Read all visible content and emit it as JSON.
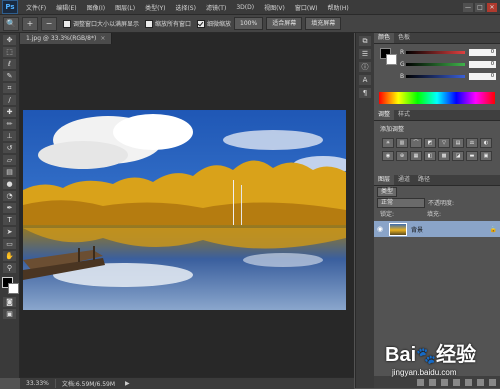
{
  "app": {
    "logo": "Ps",
    "menu": [
      "文件(F)",
      "编辑(E)",
      "图像(I)",
      "图层(L)",
      "类型(Y)",
      "选择(S)",
      "滤镜(T)",
      "3D(D)",
      "视图(V)",
      "窗口(W)",
      "帮助(H)"
    ],
    "window_controls": [
      "—",
      "□",
      "✕"
    ]
  },
  "options_bar": {
    "resize_windows_label": "调整窗口大小以满屏显示",
    "zoom_all_label": "缩放所有窗口",
    "scrubby_zoom_label": "细微缩放",
    "btn_100": "100%",
    "btn_fit": "适合屏幕",
    "btn_fill": "填充屏幕"
  },
  "document": {
    "tab_title": "1.jpg @ 33.3%(RGB/8*)",
    "zoom": "33.33%",
    "doc_size": "文档:6.59M/6.59M"
  },
  "color_panel": {
    "tabs": [
      "颜色",
      "色板"
    ],
    "sliders": [
      {
        "label": "R",
        "value": "0",
        "color": "#e04040"
      },
      {
        "label": "G",
        "value": "0",
        "color": "#3fb34a"
      },
      {
        "label": "B",
        "value": "0",
        "color": "#3a5fd6"
      }
    ]
  },
  "adjustments_panel": {
    "tabs": [
      "调整",
      "样式"
    ],
    "title": "添加调整"
  },
  "layers_panel": {
    "tabs": [
      "图层",
      "通道",
      "路径"
    ],
    "kind": "类型",
    "blend_mode": "正常",
    "opacity_label": "不透明度:",
    "lock_label": "锁定:",
    "fill_label": "填充:",
    "layer_name": "背景"
  },
  "watermark": {
    "brand": "Bai&#xe6;经验",
    "url": "jingyan.baidu.com"
  }
}
